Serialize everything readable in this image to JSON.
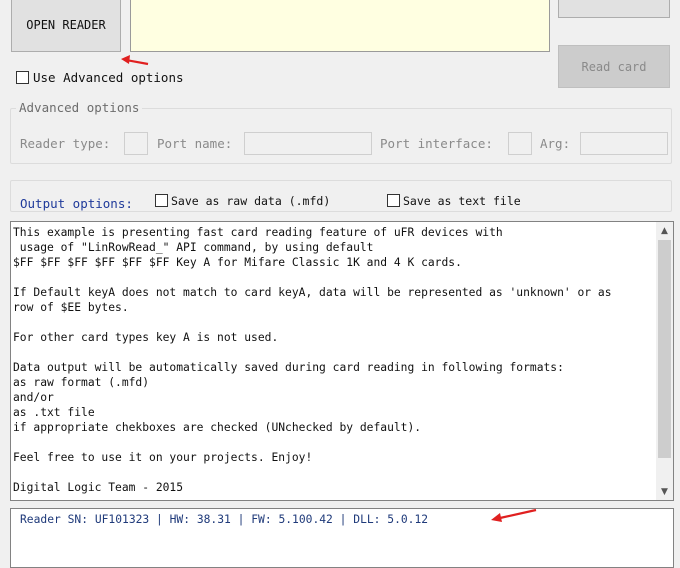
{
  "buttons": {
    "open_reader": "OPEN READER",
    "read_card": "Read card"
  },
  "advanced_checkbox_label": "Use Advanced options",
  "advanced_group": {
    "title": "Advanced options",
    "reader_type_label": "Reader type:",
    "port_name_label": "Port name:",
    "port_interface_label": "Port interface:",
    "arg_label": "Arg:"
  },
  "output_options": {
    "title": "Output options:",
    "raw_label": "Save as raw data (.mfd)",
    "text_label": "Save as text file"
  },
  "memo": {
    "lines": [
      "This example is presenting fast card reading feature of uFR devices with",
      " usage of \"LinRowRead_\" API command, by using default",
      "$FF $FF $FF $FF $FF $FF Key A for Mifare Classic 1K and 4 K cards.",
      "",
      "If Default keyA does not match to card keyA, data will be represented as 'unknown' or as",
      "row of $EE bytes.",
      "",
      "For other card types key A is not used.",
      "",
      "Data output will be automatically saved during card reading in following formats:",
      "as raw format (.mfd)",
      "and/or",
      "as .txt file",
      "if appropriate chekboxes are checked (UNchecked by default).",
      "",
      "Feel free to use it on your projects. Enjoy!",
      "",
      "Digital Logic Team - 2015"
    ]
  },
  "status": {
    "reader_info": "Reader SN: UF101323 | HW: 38.31 | FW: 5.100.42 | DLL: 5.0.12"
  },
  "colors": {
    "annotation_arrow": "#e02020",
    "status_text": "#1f3a7a",
    "info_box": "#ffffe1"
  }
}
